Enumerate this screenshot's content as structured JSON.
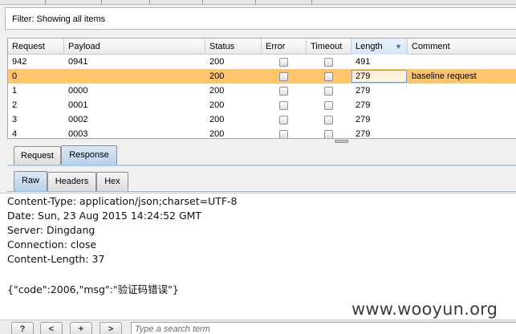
{
  "filter": {
    "text": "Filter: Showing all items"
  },
  "table": {
    "columns": {
      "request": "Request",
      "payload": "Payload",
      "status": "Status",
      "error": "Error",
      "timeout": "Timeout",
      "length": "Length",
      "comment": "Comment"
    },
    "sorted_column": "Length",
    "sort_indicator": "▼",
    "selected_row_index": 1,
    "rows": [
      {
        "request": "942",
        "payload": "0941",
        "status": "200",
        "error": false,
        "timeout": false,
        "length": "491",
        "comment": ""
      },
      {
        "request": "0",
        "payload": "",
        "status": "200",
        "error": false,
        "timeout": false,
        "length": "279",
        "comment": "baseline request"
      },
      {
        "request": "1",
        "payload": "0000",
        "status": "200",
        "error": false,
        "timeout": false,
        "length": "279",
        "comment": ""
      },
      {
        "request": "2",
        "payload": "0001",
        "status": "200",
        "error": false,
        "timeout": false,
        "length": "279",
        "comment": ""
      },
      {
        "request": "3",
        "payload": "0002",
        "status": "200",
        "error": false,
        "timeout": false,
        "length": "279",
        "comment": ""
      },
      {
        "request": "4",
        "payload": "0003",
        "status": "200",
        "error": false,
        "timeout": false,
        "length": "279",
        "comment": ""
      }
    ]
  },
  "message_tabs": {
    "request": "Request",
    "response": "Response",
    "active": "Response"
  },
  "view_tabs": {
    "raw": "Raw",
    "headers": "Headers",
    "hex": "Hex",
    "active": "Raw"
  },
  "response": {
    "lines": [
      "Content-Type: application/json;charset=UTF-8",
      "Date: Sun, 23 Aug 2015 14:24:52 GMT",
      "Server: Dingdang",
      "Connection: close",
      "Content-Length: 37",
      "",
      "{\"code\":2006,\"msg\":\"验证码错误\"}"
    ]
  },
  "watermark": "www.wooyun.org",
  "bottom_bar": {
    "help_label": "?",
    "prev_label": "<",
    "add_label": "+",
    "next_label": ">",
    "search_placeholder": "Type a search term"
  },
  "colors": {
    "selected_row": "#ffc46c",
    "active_tab": "#b6d1ea"
  }
}
